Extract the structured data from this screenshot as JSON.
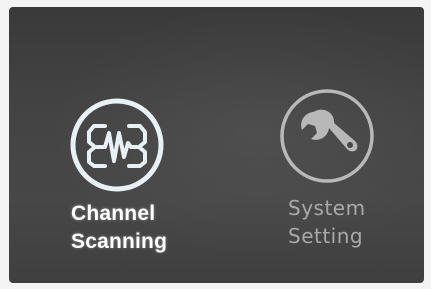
{
  "menu": {
    "items": [
      {
        "label_line1": "Channel",
        "label_line2": "Scanning",
        "icon": "channel-scanning-icon",
        "selected": true
      },
      {
        "label_line1": "System",
        "label_line2": "Setting",
        "icon": "wrench-icon",
        "selected": false
      }
    ]
  },
  "colors": {
    "screen_background": "#434343",
    "selected_text": "#ffffff",
    "unselected_text": "#a9a9a9",
    "selected_icon": "#eaf4f8",
    "unselected_icon": "#b5b5b5"
  }
}
